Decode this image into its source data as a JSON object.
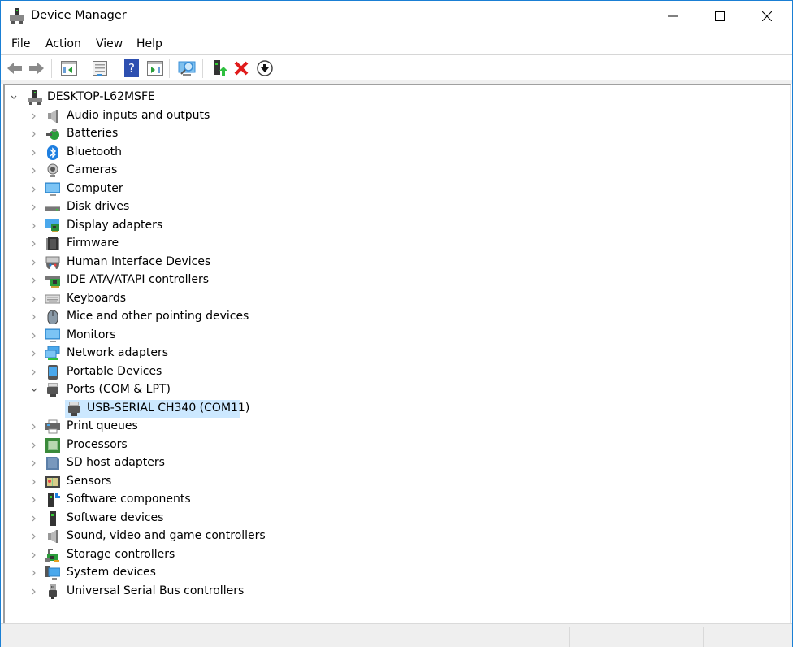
{
  "window": {
    "title": "Device Manager",
    "controls": {
      "minimize": "minimize-icon",
      "maximize": "maximize-icon",
      "close": "close-icon"
    }
  },
  "menu": [
    "File",
    "Action",
    "View",
    "Help"
  ],
  "toolbar": [
    {
      "name": "back-button",
      "icon": "arrow-left-icon"
    },
    {
      "name": "forward-button",
      "icon": "arrow-right-icon"
    },
    {
      "name": "show-hide-console-tree-button",
      "icon": "console-tree-icon"
    },
    {
      "name": "properties-button",
      "icon": "properties-icon"
    },
    {
      "name": "help-button",
      "icon": "help-icon"
    },
    {
      "name": "show-hide-action-pane-button",
      "icon": "action-pane-icon"
    },
    {
      "name": "scan-hardware-changes-button",
      "icon": "scan-monitor-icon"
    },
    {
      "name": "update-driver-button",
      "icon": "update-driver-icon"
    },
    {
      "name": "uninstall-device-button",
      "icon": "red-x-icon"
    },
    {
      "name": "disable-device-button",
      "icon": "down-arrow-circle-icon"
    }
  ],
  "tree": {
    "root": {
      "label": "DESKTOP-L62MSFE",
      "icon": "computer-tower-icon",
      "expanded": true
    },
    "categories": [
      {
        "label": "Audio inputs and outputs",
        "icon": "speaker-icon"
      },
      {
        "label": "Batteries",
        "icon": "battery-icon"
      },
      {
        "label": "Bluetooth",
        "icon": "bluetooth-icon"
      },
      {
        "label": "Cameras",
        "icon": "webcam-icon"
      },
      {
        "label": "Computer",
        "icon": "monitor-icon"
      },
      {
        "label": "Disk drives",
        "icon": "disk-drive-icon"
      },
      {
        "label": "Display adapters",
        "icon": "display-adapter-icon"
      },
      {
        "label": "Firmware",
        "icon": "chip-icon"
      },
      {
        "label": "Human Interface Devices",
        "icon": "hid-icon"
      },
      {
        "label": "IDE ATA/ATAPI controllers",
        "icon": "ide-controller-icon"
      },
      {
        "label": "Keyboards",
        "icon": "keyboard-icon"
      },
      {
        "label": "Mice and other pointing devices",
        "icon": "mouse-icon"
      },
      {
        "label": "Monitors",
        "icon": "monitor-icon"
      },
      {
        "label": "Network adapters",
        "icon": "network-icon"
      },
      {
        "label": "Portable Devices",
        "icon": "portable-device-icon"
      },
      {
        "label": "Ports (COM & LPT)",
        "icon": "port-icon",
        "expanded": true,
        "children": [
          {
            "label": "USB-SERIAL CH340 (COM11)",
            "icon": "port-icon",
            "selected": true
          }
        ]
      },
      {
        "label": "Print queues",
        "icon": "printer-icon"
      },
      {
        "label": "Processors",
        "icon": "processor-icon"
      },
      {
        "label": "SD host adapters",
        "icon": "sd-card-icon"
      },
      {
        "label": "Sensors",
        "icon": "sensor-icon"
      },
      {
        "label": "Software components",
        "icon": "software-component-icon"
      },
      {
        "label": "Software devices",
        "icon": "software-device-icon"
      },
      {
        "label": "Sound, video and game controllers",
        "icon": "speaker-icon"
      },
      {
        "label": "Storage controllers",
        "icon": "storage-controller-icon"
      },
      {
        "label": "System devices",
        "icon": "system-devices-icon"
      },
      {
        "label": "Universal Serial Bus controllers",
        "icon": "usb-plug-icon"
      }
    ]
  },
  "colors": {
    "selection": "#cce8ff",
    "frame": "#1a7fd4"
  }
}
